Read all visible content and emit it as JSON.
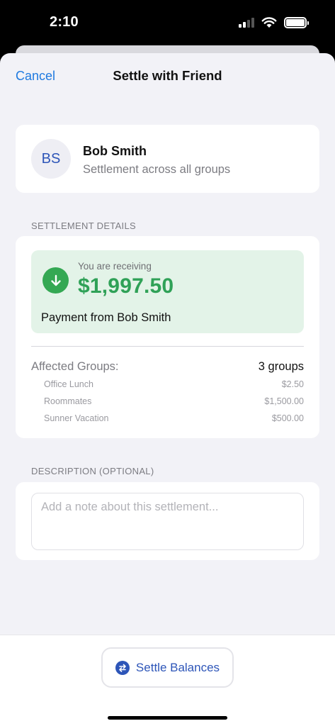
{
  "status_bar": {
    "time": "2:10"
  },
  "nav": {
    "cancel_label": "Cancel",
    "title": "Settle with Friend"
  },
  "friend": {
    "initials": "BS",
    "name": "Bob Smith",
    "subtitle": "Settlement across all groups"
  },
  "settlement_details": {
    "header": "SETTLEMENT DETAILS",
    "receiving_label": "You are receiving",
    "amount": "$1,997.50",
    "payment_from": "Payment from Bob Smith",
    "affected_label": "Affected Groups:",
    "affected_count": "3 groups",
    "groups": [
      {
        "name": "Office Lunch",
        "amount": "$2.50"
      },
      {
        "name": "Roommates",
        "amount": "$1,500.00"
      },
      {
        "name": "Sunner Vacation",
        "amount": "$500.00"
      }
    ]
  },
  "description": {
    "header": "DESCRIPTION (OPTIONAL)",
    "placeholder": "Add a note about this settlement..."
  },
  "action": {
    "settle_label": "Settle Balances"
  },
  "colors": {
    "accent": "#1f7ae0",
    "positive": "#2fa157",
    "positive_bg": "#e3f3e8",
    "brand_blue": "#2d55b8"
  }
}
